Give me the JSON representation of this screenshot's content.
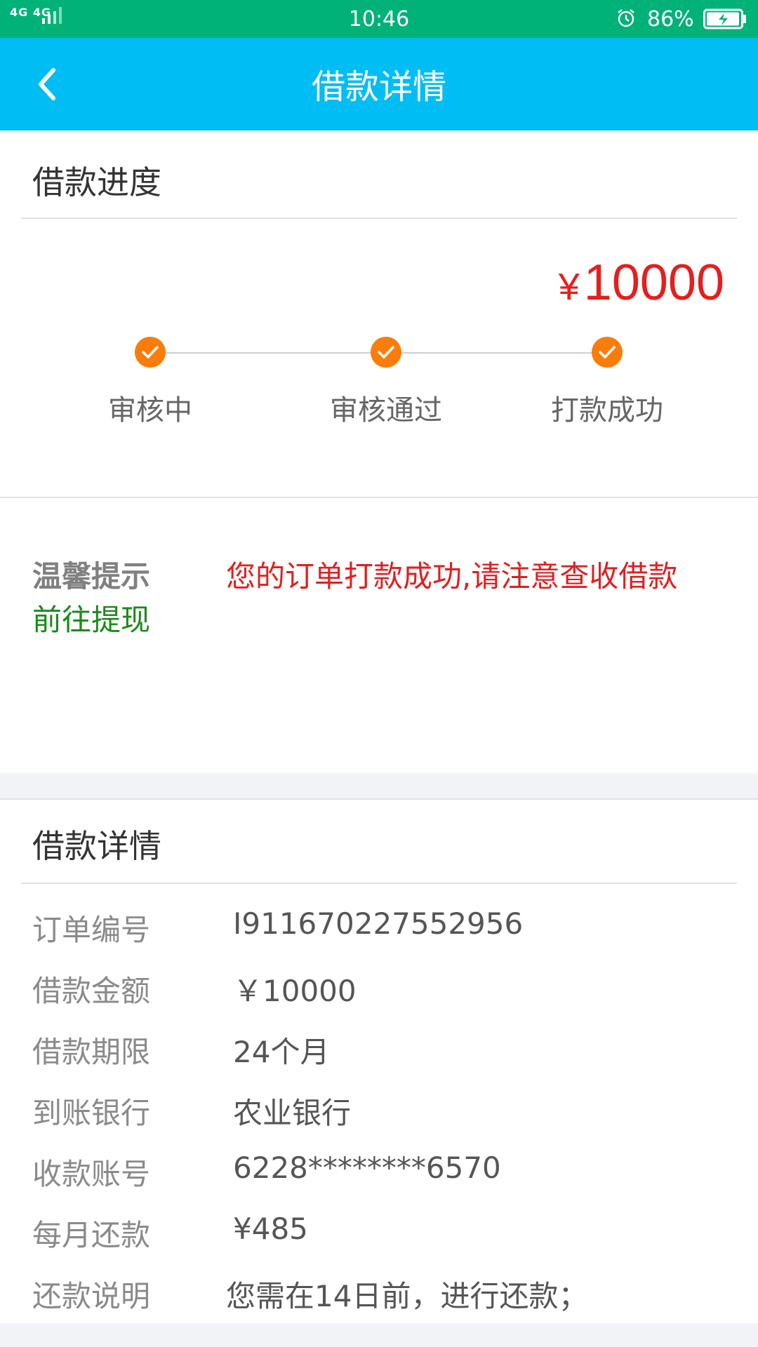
{
  "status_bar": {
    "network": "4G 4G",
    "time": "10:46",
    "battery": "86%",
    "icons": [
      "signal-icon",
      "alarm-icon",
      "battery-charging-icon"
    ]
  },
  "header": {
    "title": "借款详情",
    "back_icon": "chevron-left-icon"
  },
  "progress": {
    "section_title": "借款进度",
    "amount": "10000",
    "currency_symbol": "¥",
    "steps": [
      {
        "label": "审核中",
        "done": true
      },
      {
        "label": "审核通过",
        "done": true
      },
      {
        "label": "打款成功",
        "done": true
      }
    ],
    "tip_label": "温馨提示",
    "tip_message": "您的订单打款成功,请注意查收借款",
    "withdraw_link": "前往提现"
  },
  "details": {
    "section_title": "借款详情",
    "rows": [
      {
        "label": "订单编号",
        "value": "I911670227552956"
      },
      {
        "label": "借款金额",
        "value": "￥10000"
      },
      {
        "label": "借款期限",
        "value": "24个月"
      },
      {
        "label": "到账银行",
        "value": "农业银行"
      },
      {
        "label": "收款账号",
        "value": "6228********6570"
      },
      {
        "label": "每月还款",
        "value": "¥485"
      },
      {
        "label": "还款说明",
        "value": "您需在14日前，进行还款；"
      }
    ]
  },
  "colors": {
    "status_bar": "#00b277",
    "nav_bar": "#00bdf4",
    "amount": "#e61e1e",
    "step_dot": "#fa7d0a",
    "tip_message": "#e02020",
    "withdraw_link": "#1b8a1b"
  }
}
